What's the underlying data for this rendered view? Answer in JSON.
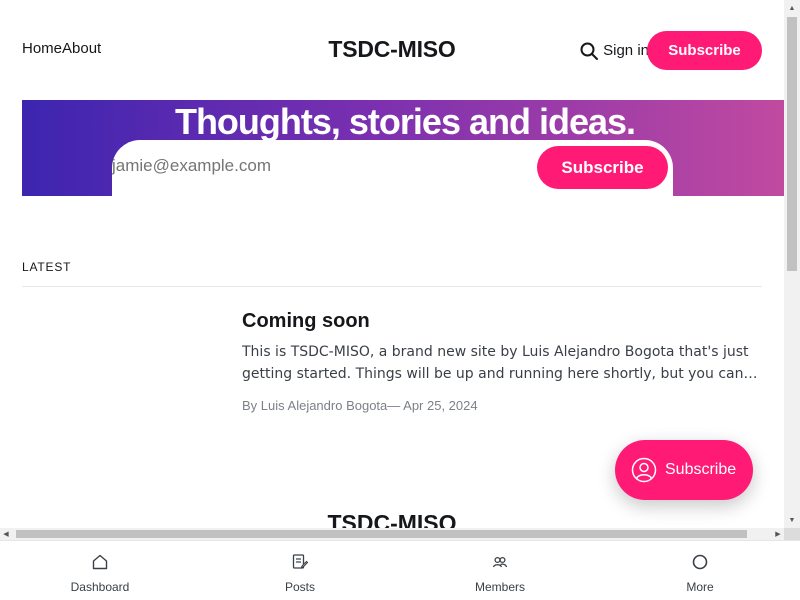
{
  "header": {
    "nav": [
      {
        "label": "Home"
      },
      {
        "label": "About"
      }
    ],
    "site_title": "TSDC-MISO",
    "signin_label": "Sign in",
    "subscribe_label": "Subscribe"
  },
  "hero": {
    "title": "Thoughts, stories and ideas.",
    "email_placeholder": "jamie@example.com",
    "subscribe_label": "Subscribe"
  },
  "latest": {
    "label": "LATEST",
    "posts": [
      {
        "title": "Coming soon",
        "excerpt": "This is TSDC-MISO, a brand new site by Luis Alejandro Bogota that's just getting started. Things will be up and running here shortly, but you can…",
        "meta": "By Luis Alejandro Bogota— Apr 25, 2024"
      }
    ]
  },
  "footer": {
    "site_title": "TSDC-MISO"
  },
  "portal": {
    "label": "Subscribe",
    "icon": "user-circle-icon"
  },
  "tabbar": {
    "tabs": [
      {
        "label": "Dashboard",
        "icon": "home-icon"
      },
      {
        "label": "Posts",
        "icon": "posts-edit-icon"
      },
      {
        "label": "Members",
        "icon": "members-icon"
      },
      {
        "label": "More",
        "icon": "circle-icon"
      }
    ]
  },
  "colors": {
    "accent": "#ff1a75",
    "hero_gradient_start": "#3c25b0",
    "hero_gradient_end": "#c04aa0"
  }
}
